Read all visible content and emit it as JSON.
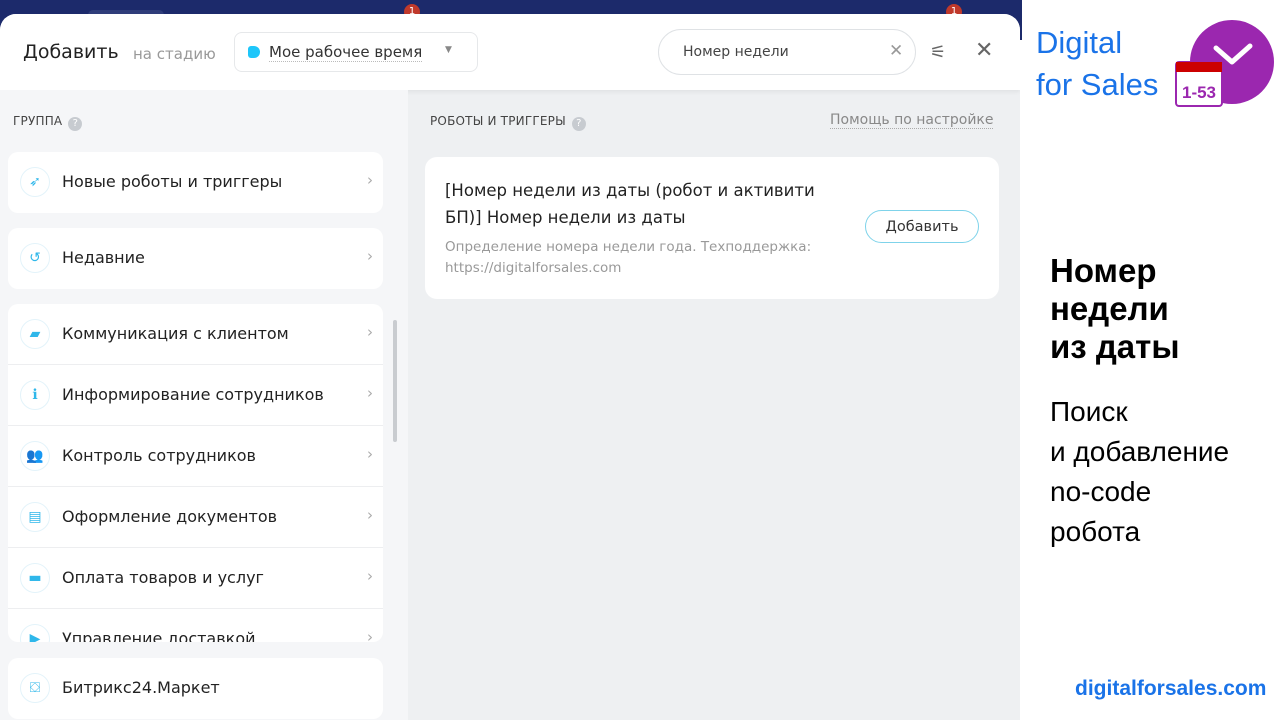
{
  "background": {
    "badges": [
      "1",
      "1"
    ]
  },
  "header": {
    "title": "Добавить",
    "stage_prefix": "на стадию",
    "stage": "Мое рабочее время",
    "search_value": "Номер недели",
    "icons": [
      "close-icon",
      "filter-icon",
      "close-icon"
    ]
  },
  "left": {
    "section_label": "ГРУППА",
    "top_items": [
      {
        "label": "Новые роботы и триггеры",
        "icon": "rocket-icon"
      },
      {
        "label": "Недавние",
        "icon": "history-icon"
      }
    ],
    "groups": [
      {
        "label": "Коммуникация с клиентом",
        "icon": "chat-icon"
      },
      {
        "label": "Информирование сотрудников",
        "icon": "info-icon"
      },
      {
        "label": "Контроль сотрудников",
        "icon": "users-icon"
      },
      {
        "label": "Оформление документов",
        "icon": "document-icon"
      },
      {
        "label": "Оплата товаров и услуг",
        "icon": "wallet-icon"
      },
      {
        "label": "Управление доставкой",
        "icon": "truck-icon"
      }
    ],
    "market": {
      "label": "Битрикс24.Маркет",
      "icon": "market-icon"
    }
  },
  "main": {
    "section_label": "РОБОТЫ И ТРИГГЕРЫ",
    "help_link": "Помощь по настройке",
    "robot": {
      "title": "[Номер недели из даты (робот и активити БП)] Номер недели из даты",
      "description": "Определение номера недели года. Техподдержка: https://digitalforsales.com",
      "button": "Добавить"
    }
  },
  "promo": {
    "brand_line1": "Digital",
    "brand_line2": "for Sales",
    "logo_text": "1-53",
    "headline": [
      "Номер",
      "недели",
      "из даты"
    ],
    "subline": [
      "Поиск",
      "и добавление",
      "no-code",
      "робота"
    ],
    "site": "digitalforsales.com",
    "colors": {
      "brand": "#1a73e8",
      "logo": "#9b27af",
      "calendar": "#cc0000"
    }
  }
}
